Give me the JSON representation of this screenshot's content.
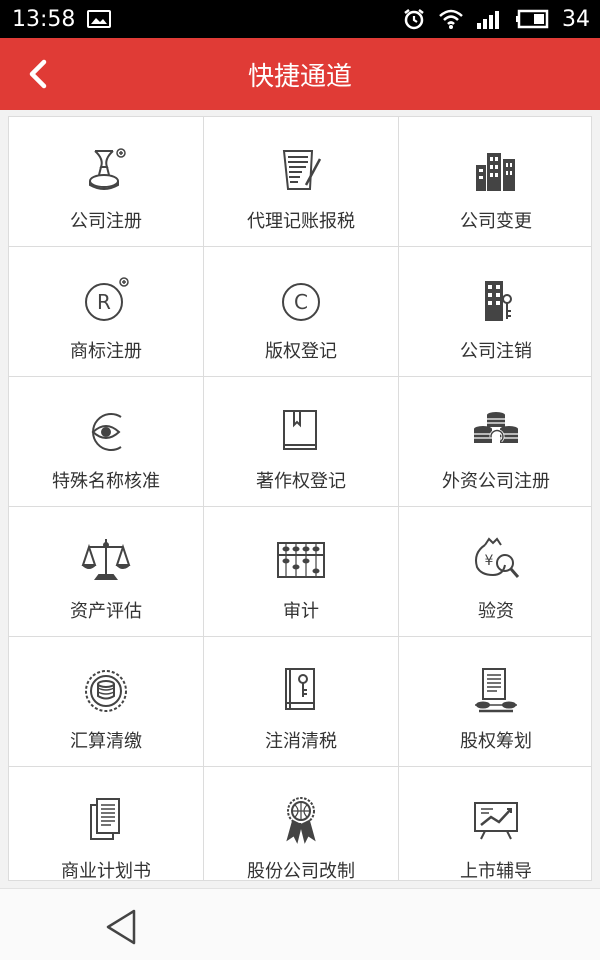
{
  "status_bar": {
    "time": "13:58",
    "battery": "34"
  },
  "header": {
    "title": "快捷通道"
  },
  "grid": {
    "items": [
      {
        "label": "公司注册",
        "icon": "stamp-icon"
      },
      {
        "label": "代理记账报税",
        "icon": "document-pen-icon"
      },
      {
        "label": "公司变更",
        "icon": "buildings-icon"
      },
      {
        "label": "商标注册",
        "icon": "registered-mark-icon"
      },
      {
        "label": "版权登记",
        "icon": "copyright-icon"
      },
      {
        "label": "公司注销",
        "icon": "building-key-icon"
      },
      {
        "label": "特殊名称核准",
        "icon": "eye-icon"
      },
      {
        "label": "著作权登记",
        "icon": "book-icon"
      },
      {
        "label": "外资公司注册",
        "icon": "coin-stacks-icon"
      },
      {
        "label": "资产评估",
        "icon": "balance-scale-icon"
      },
      {
        "label": "审计",
        "icon": "abacus-icon"
      },
      {
        "label": "验资",
        "icon": "money-bag-magnifier-icon"
      },
      {
        "label": "汇算清缴",
        "icon": "coin-seal-icon"
      },
      {
        "label": "注消清税",
        "icon": "book-key-icon"
      },
      {
        "label": "股权筹划",
        "icon": "document-coins-icon"
      },
      {
        "label": "商业计划书",
        "icon": "papers-icon"
      },
      {
        "label": "股份公司改制",
        "icon": "globe-ribbon-icon"
      },
      {
        "label": "上市辅导",
        "icon": "chart-board-icon"
      }
    ]
  },
  "colors": {
    "accent": "#e03b36",
    "icon": "#444444",
    "divider": "#dcdcdc"
  }
}
